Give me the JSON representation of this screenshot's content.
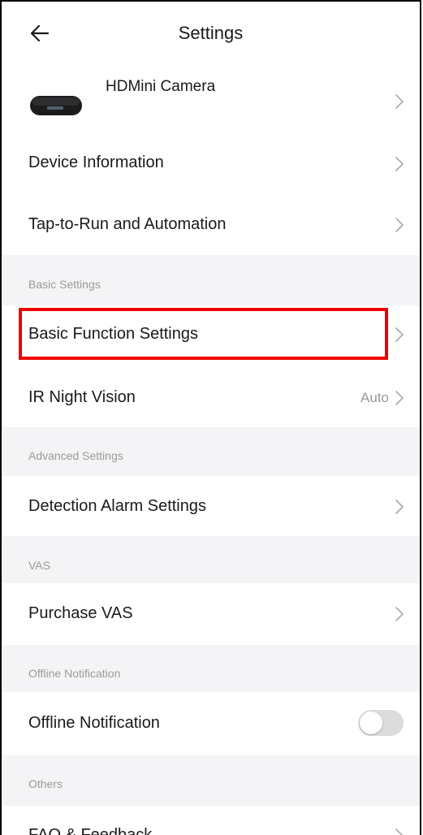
{
  "header": {
    "title": "Settings",
    "back_icon": "arrow-left-icon"
  },
  "device": {
    "name": "HDMini Camera",
    "image_icon": "camera-icon"
  },
  "rows": {
    "device_information": "Device Information",
    "tap_to_run": "Tap-to-Run and Automation",
    "basic_function_settings": "Basic Function Settings",
    "ir_night_vision": "IR Night Vision",
    "ir_night_vision_value": "Auto",
    "detection_alarm_settings": "Detection Alarm Settings",
    "purchase_vas": "Purchase VAS",
    "offline_notification": "Offline Notification",
    "offline_notification_enabled": false,
    "faq_feedback": "FAQ & Feedback"
  },
  "sections": {
    "basic": "Basic Settings",
    "advanced": "Advanced Settings",
    "vas": "VAS",
    "offline": "Offline Notification",
    "others": "Others"
  },
  "colors": {
    "highlight": "#ee0000",
    "section_bg": "#f4f4f6",
    "muted_text": "#9a9a9a",
    "toggle_off": "#dcdcdc"
  }
}
